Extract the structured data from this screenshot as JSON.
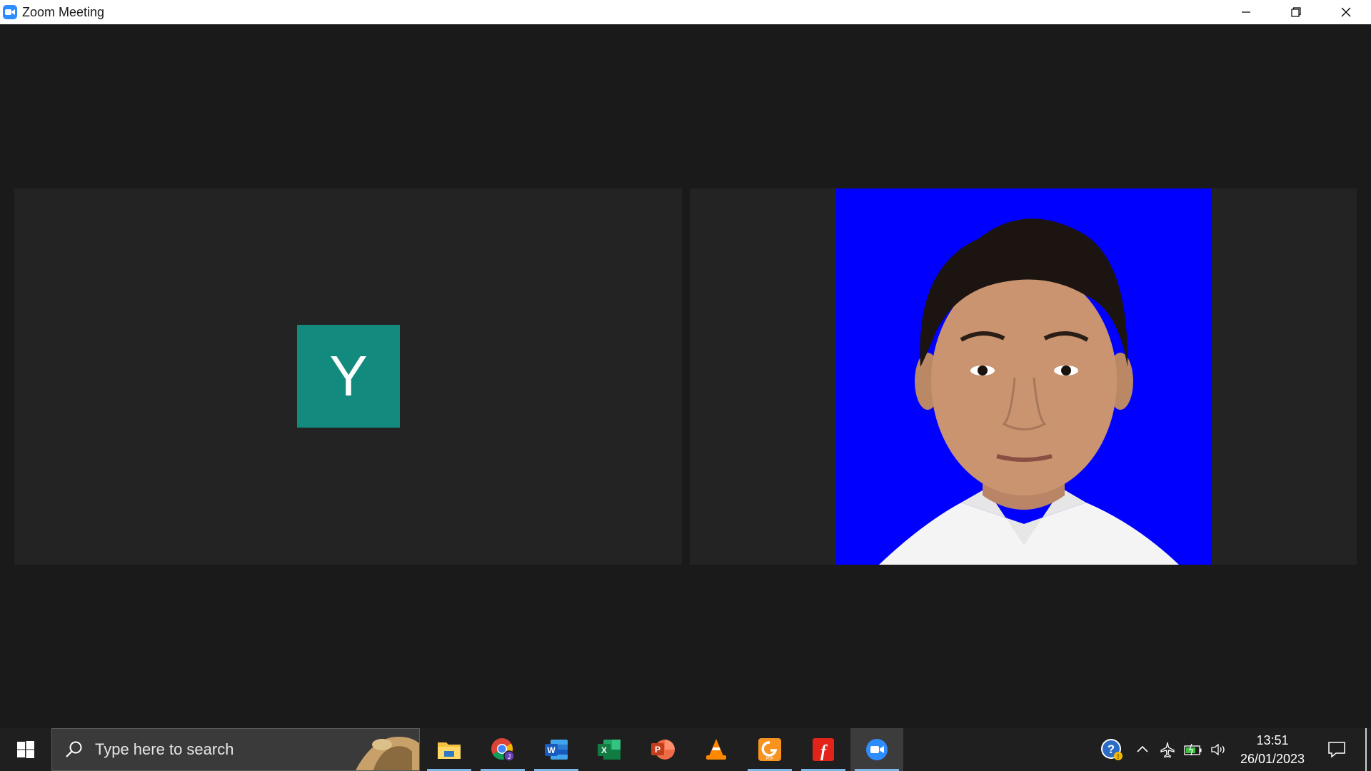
{
  "window": {
    "title": "Zoom Meeting",
    "controls": [
      "minimize",
      "restore",
      "close"
    ]
  },
  "meeting": {
    "participants": [
      {
        "avatar_initial": "Y",
        "avatar_color": "#138a7e",
        "video": false
      },
      {
        "video": true,
        "background_color": "#0000ff"
      }
    ]
  },
  "taskbar": {
    "search_placeholder": "Type here to search",
    "apps": [
      {
        "name": "File Explorer",
        "icon": "folder-icon",
        "running": true
      },
      {
        "name": "Google Chrome",
        "icon": "chrome-icon",
        "running": true
      },
      {
        "name": "Microsoft Word",
        "icon": "word-icon",
        "running": true
      },
      {
        "name": "Microsoft Excel",
        "icon": "excel-icon",
        "running": false
      },
      {
        "name": "Microsoft PowerPoint",
        "icon": "powerpoint-icon",
        "running": false
      },
      {
        "name": "VLC",
        "icon": "vlc-icon",
        "running": false
      },
      {
        "name": "Gitmind POP",
        "icon": "pop-icon",
        "running": true
      },
      {
        "name": "Foxit",
        "icon": "foxit-icon",
        "running": true
      },
      {
        "name": "Zoom",
        "icon": "zoom-icon",
        "running": true,
        "active": true
      }
    ],
    "clock": {
      "time": "13:51",
      "date": "26/01/2023"
    }
  }
}
